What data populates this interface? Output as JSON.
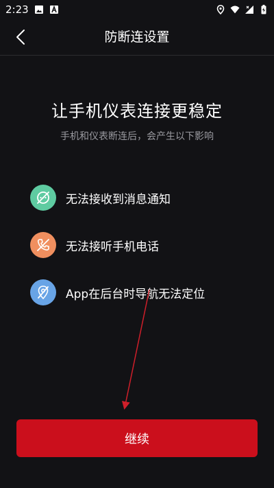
{
  "status_bar": {
    "time": "2:23"
  },
  "header": {
    "title": "防断连设置"
  },
  "main": {
    "headline": "让手机仪表连接更稳定",
    "subtitle": "手机和仪表断连后，会产生以下影响",
    "impacts": [
      {
        "label": "无法接收到消息通知",
        "icon": "message-off-icon",
        "color": "#5ecba1"
      },
      {
        "label": "无法接听手机电话",
        "icon": "phone-off-icon",
        "color": "#f08f5f"
      },
      {
        "label": "App在后台时导航无法定位",
        "icon": "location-off-icon",
        "color": "#68a4e6"
      }
    ]
  },
  "footer": {
    "continue_label": "继续"
  },
  "colors": {
    "background": "#121215",
    "accent": "#cb0f1c"
  }
}
